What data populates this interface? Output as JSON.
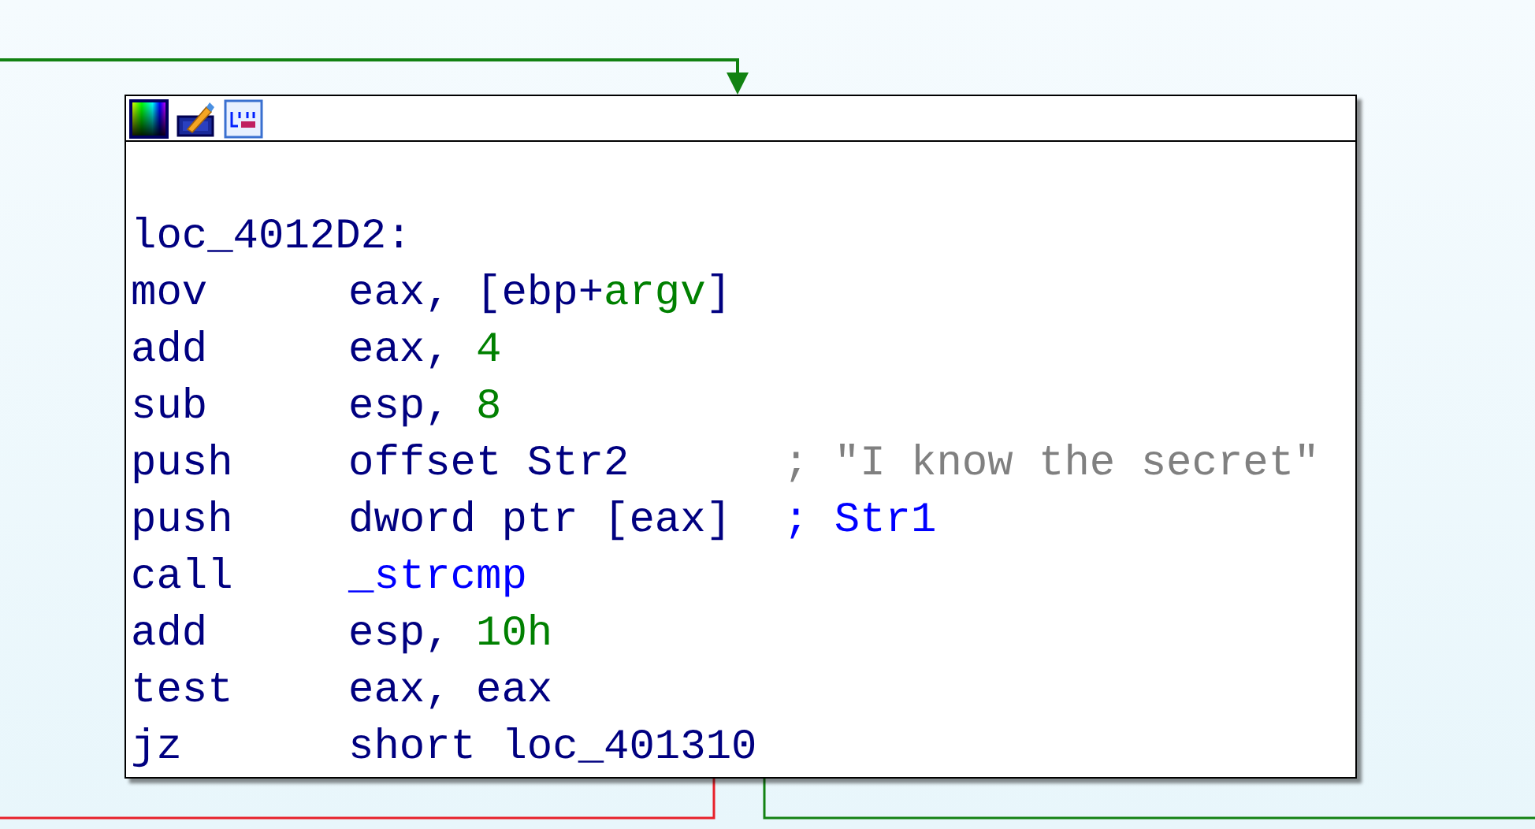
{
  "edges": [
    {
      "kind": "incoming",
      "color": "#128212"
    },
    {
      "kind": "false",
      "color": "#e8202a"
    },
    {
      "kind": "true",
      "color": "#128212"
    }
  ],
  "node": {
    "label": "loc_4012D2:",
    "instructions": [
      {
        "mnemonic": "mov",
        "operands": [
          {
            "kind": "reg",
            "text": "eax, [ebp+"
          },
          {
            "kind": "var",
            "text": "argv"
          },
          {
            "kind": "reg",
            "text": "]"
          }
        ]
      },
      {
        "mnemonic": "add",
        "operands": [
          {
            "kind": "reg",
            "text": "eax, "
          },
          {
            "kind": "num",
            "text": "4"
          }
        ]
      },
      {
        "mnemonic": "sub",
        "operands": [
          {
            "kind": "reg",
            "text": "esp, "
          },
          {
            "kind": "num",
            "text": "8"
          }
        ]
      },
      {
        "mnemonic": "push",
        "operands": [
          {
            "kind": "reg",
            "text": "offset Str2"
          }
        ],
        "comment": {
          "kind": "string",
          "text": "; \"I know the secret\""
        }
      },
      {
        "mnemonic": "push",
        "operands": [
          {
            "kind": "reg",
            "text": "dword ptr [eax]"
          }
        ],
        "comment": {
          "kind": "name",
          "text": "; Str1"
        }
      },
      {
        "mnemonic": "call",
        "operands": [
          {
            "kind": "name",
            "text": "_strcmp"
          }
        ]
      },
      {
        "mnemonic": "add",
        "operands": [
          {
            "kind": "reg",
            "text": "esp, "
          },
          {
            "kind": "num",
            "text": "10h"
          }
        ]
      },
      {
        "mnemonic": "test",
        "operands": [
          {
            "kind": "reg",
            "text": "eax, eax"
          }
        ]
      },
      {
        "mnemonic": "jz",
        "operands": [
          {
            "kind": "reg",
            "text": "short loc_401310"
          }
        ]
      }
    ]
  }
}
